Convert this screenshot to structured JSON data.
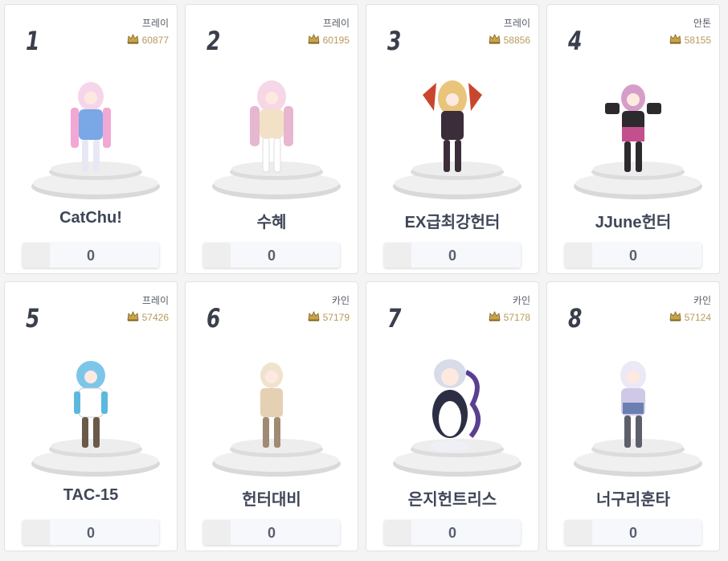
{
  "cards": [
    {
      "rank": "1",
      "server": "프레이",
      "fame": "60877",
      "name": "CatChu!",
      "votes": "0",
      "color": "#7aa7e6",
      "accent": "#f2a8d4",
      "hair": "#f6d5ea"
    },
    {
      "rank": "2",
      "server": "프레이",
      "fame": "60195",
      "name": "수혜",
      "votes": "0",
      "color": "#f3e1c7",
      "accent": "#e7b6cf",
      "hair": "#f6d7e6"
    },
    {
      "rank": "3",
      "server": "프레이",
      "fame": "58856",
      "name": "EX급최강헌터",
      "votes": "0",
      "color": "#3b2d3a",
      "accent": "#c9462d",
      "hair": "#e9c47b"
    },
    {
      "rank": "4",
      "server": "안톤",
      "fame": "58155",
      "name": "JJune헌터",
      "votes": "0",
      "color": "#2d2a2e",
      "accent": "#c34f8e",
      "hair": "#d59ec9"
    },
    {
      "rank": "5",
      "server": "프레이",
      "fame": "57426",
      "name": "TAC-15",
      "votes": "0",
      "color": "#ffffff",
      "accent": "#5bb9dd",
      "hair": "#7cc6ea"
    },
    {
      "rank": "6",
      "server": "카인",
      "fame": "57179",
      "name": "헌터대비",
      "votes": "0",
      "color": "#e5d0b4",
      "accent": "#9f8b72",
      "hair": "#efe3cf"
    },
    {
      "rank": "7",
      "server": "카인",
      "fame": "57178",
      "name": "은지헌트리스",
      "votes": "0",
      "color": "#2c2f44",
      "accent": "#d8dbe8",
      "hair": "#ffffff"
    },
    {
      "rank": "8",
      "server": "카인",
      "fame": "57124",
      "name": "너구리훈타",
      "votes": "0",
      "color": "#6c7fb1",
      "accent": "#cfc9e7",
      "hair": "#ece8f6"
    }
  ]
}
